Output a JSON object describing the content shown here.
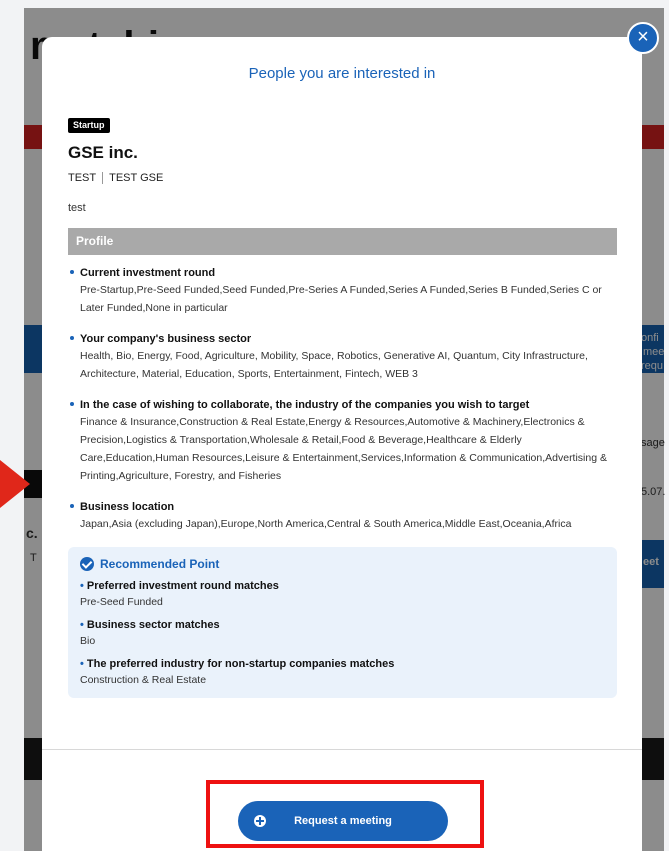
{
  "background": {
    "title_fragment": "matchi",
    "left_fragments": [
      "c.",
      "T"
    ],
    "right_fragments": [
      "onfi",
      "mee",
      "requ",
      "sage",
      "5.07.",
      "eet"
    ]
  },
  "modal": {
    "header": "People you are interested in",
    "tag": "Startup",
    "company_name": "GSE inc.",
    "person_first": "TEST",
    "person_second": "TEST GSE",
    "description": "test",
    "profile_label": "Profile",
    "items": [
      {
        "title": "Current investment round",
        "value": "Pre-Startup,Pre-Seed Funded,Seed Funded,Pre-Series A Funded,Series A Funded,Series B Funded,Series C or Later Funded,None in particular"
      },
      {
        "title": "Your company's business sector",
        "value": "Health, Bio, Energy, Food, Agriculture, Mobility, Space, Robotics, Generative AI, Quantum, City Infrastructure, Architecture, Material, Education, Sports, Entertainment, Fintech, WEB 3"
      },
      {
        "title": "In the case of wishing to collaborate, the industry of the companies you wish to target",
        "value": "Finance & Insurance,Construction & Real Estate,Energy & Resources,Automotive & Machinery,Electronics & Precision,Logistics & Transportation,Wholesale & Retail,Food & Beverage,Healthcare & Elderly Care,Education,Human Resources,Leisure & Entertainment,Services,Information & Communication,Advertising & Printing,Agriculture, Forestry, and Fisheries"
      },
      {
        "title": "Business location",
        "value": "Japan,Asia (excluding Japan),Europe,North America,Central & South America,Middle East,Oceania,Africa"
      }
    ],
    "recommended": {
      "heading": "Recommended Point",
      "points": [
        {
          "title": "Preferred investment round matches",
          "value": "Pre-Seed Funded"
        },
        {
          "title": "Business sector matches",
          "value": "Bio"
        },
        {
          "title": "The preferred industry for non-startup companies matches",
          "value": "Construction & Real Estate"
        }
      ]
    },
    "request_button": "Request a meeting",
    "close_symbol": "×"
  },
  "colors": {
    "accent": "#1a63b8",
    "highlight": "#ee1111",
    "profile_bar": "#a9a9a9",
    "recommended_bg": "#eaf2fb"
  }
}
